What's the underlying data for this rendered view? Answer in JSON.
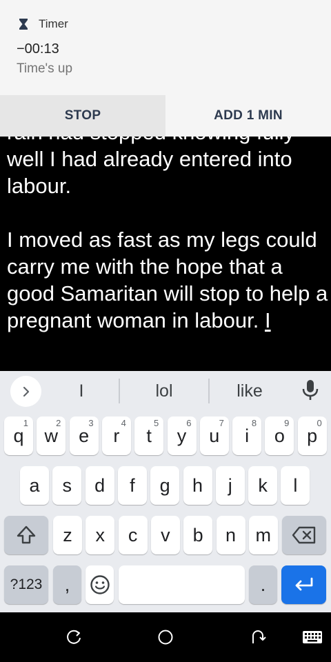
{
  "notification": {
    "app_name": "Timer",
    "icon": "hourglass-icon",
    "time": "−00:13",
    "status": "Time's up",
    "actions": {
      "stop": "STOP",
      "add_one_min": "ADD 1 MIN"
    }
  },
  "document": {
    "text_before_cursor": "rain had stopped knowing fully well I had already entered into labour.\n\nI moved as fast as my legs could carry me with the hope that a good Samaritan will stop to help a pregnant woman in labour. ",
    "current_word": "I"
  },
  "keyboard": {
    "suggestions": [
      "I",
      "lol",
      "like"
    ],
    "row1": [
      {
        "label": "q",
        "hint": "1"
      },
      {
        "label": "w",
        "hint": "2"
      },
      {
        "label": "e",
        "hint": "3"
      },
      {
        "label": "r",
        "hint": "4"
      },
      {
        "label": "t",
        "hint": "5"
      },
      {
        "label": "y",
        "hint": "6"
      },
      {
        "label": "u",
        "hint": "7"
      },
      {
        "label": "i",
        "hint": "8"
      },
      {
        "label": "o",
        "hint": "9"
      },
      {
        "label": "p",
        "hint": "0"
      }
    ],
    "row2": [
      "a",
      "s",
      "d",
      "f",
      "g",
      "h",
      "j",
      "k",
      "l"
    ],
    "row3": [
      "z",
      "x",
      "c",
      "v",
      "b",
      "n",
      "m"
    ],
    "symbols_label": "?123",
    "comma_label": ",",
    "period_label": ".",
    "space_label": ""
  },
  "colors": {
    "enter_key": "#1a73e8",
    "keyboard_bg": "#e9ebef",
    "notification_bg": "#f5f5f5"
  },
  "nav_icons": [
    "rotate-icon",
    "home-icon",
    "back-icon",
    "keyboard-switch-icon"
  ]
}
